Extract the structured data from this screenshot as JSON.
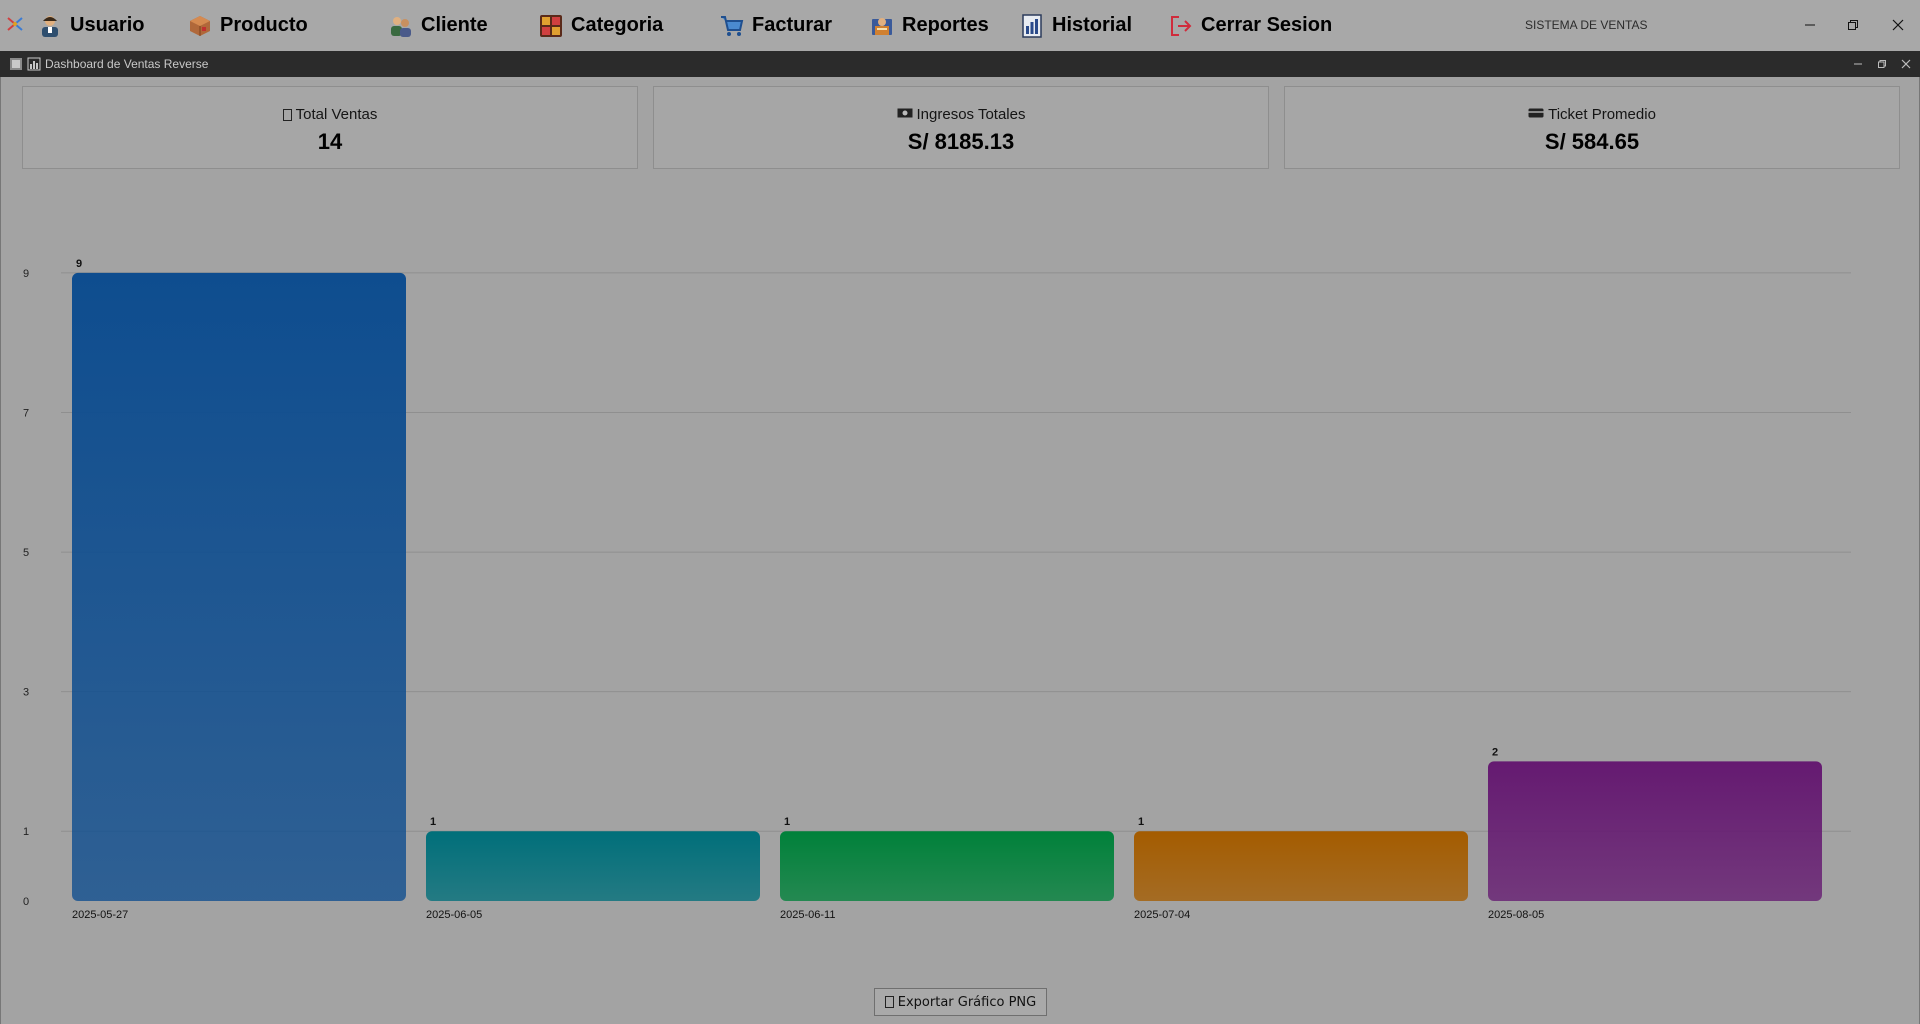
{
  "menubar": {
    "items": [
      {
        "label": "Usuario",
        "icon": "user-icon"
      },
      {
        "label": "Producto",
        "icon": "box-icon"
      },
      {
        "label": "Cliente",
        "icon": "clients-icon"
      },
      {
        "label": "Categoria",
        "icon": "category-icon"
      },
      {
        "label": "Facturar",
        "icon": "cart-icon"
      },
      {
        "label": "Reportes",
        "icon": "report-icon"
      },
      {
        "label": "Historial",
        "icon": "history-icon"
      },
      {
        "label": "Cerrar Sesion",
        "icon": "logout-icon"
      }
    ],
    "system_title": "SISTEMA DE VENTAS"
  },
  "internal_frame": {
    "title": "Dashboard de Ventas Reverse"
  },
  "cards": [
    {
      "title": "Total Ventas",
      "value": "14",
      "icon": "chart-glyph-icon"
    },
    {
      "title": "Ingresos Totales",
      "value": "S/ 8185.13",
      "icon": "money-icon"
    },
    {
      "title": "Ticket Promedio",
      "value": "S/ 584.65",
      "icon": "credit-card-icon"
    }
  ],
  "chart_data": {
    "type": "bar",
    "categories": [
      "2025-05-27",
      "2025-06-05",
      "2025-06-11",
      "2025-07-04",
      "2025-08-05"
    ],
    "values": [
      9,
      1,
      1,
      1,
      2
    ],
    "colors": [
      "#0e4d8f",
      "#006f7a",
      "#00813a",
      "#a45c00",
      "#651a71"
    ],
    "y_ticks": [
      "0",
      "1",
      "3",
      "5",
      "7",
      "9"
    ],
    "grid": true
  },
  "export": {
    "label": "Exportar Gráfico PNG"
  }
}
